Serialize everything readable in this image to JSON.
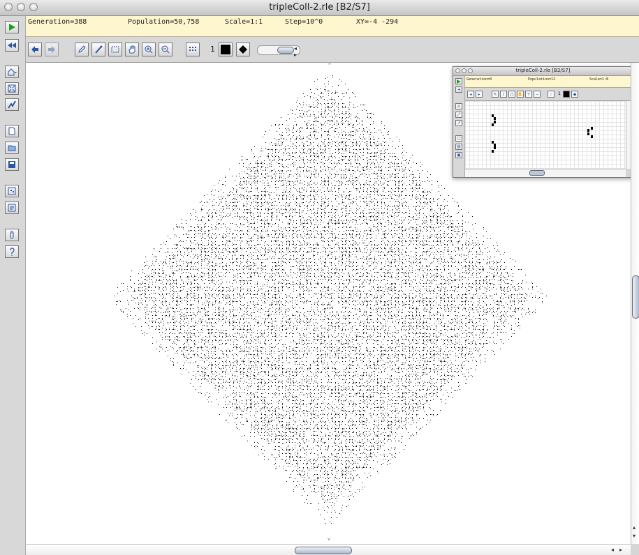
{
  "window": {
    "title": "tripleColl-2.rle [B2/S7]"
  },
  "status": {
    "generation": "Generation=388",
    "population": "Population=50,758",
    "scale": "Scale=1:1",
    "step": "Step=10^0",
    "xy": "XY=-4 -294"
  },
  "left_toolbar": {
    "items": [
      {
        "name": "start-generating-icon",
        "glyph": "▶"
      },
      {
        "name": "reset-icon",
        "glyph": "◀◀"
      },
      {
        "name": "open-pattern-icon",
        "glyph": "⌂"
      },
      {
        "name": "fit-pattern-icon",
        "glyph": "⤢"
      },
      {
        "name": "show-info-icon",
        "glyph": "↗"
      },
      {
        "name": "new-pattern-icon",
        "glyph": "▢"
      },
      {
        "name": "open-folder-icon",
        "glyph": "▤"
      },
      {
        "name": "save-pattern-icon",
        "glyph": "▣"
      },
      {
        "name": "patterns-icon",
        "glyph": "⊡"
      },
      {
        "name": "scripts-icon",
        "glyph": "▥"
      },
      {
        "name": "info-icon",
        "glyph": "i"
      },
      {
        "name": "help-icon",
        "glyph": "?"
      }
    ]
  },
  "toolbar": {
    "layer_number": "1",
    "colors": {
      "accent": "#2a56a6",
      "status_bg": "#fdf6cf",
      "play": "#1aa11a"
    }
  },
  "mini_window": {
    "title": "tripleColl-2.rle [B2/S7]",
    "generation": "Generation=0",
    "population": "Population=12",
    "scale": "Scale=1:8",
    "layer_number": "1"
  }
}
